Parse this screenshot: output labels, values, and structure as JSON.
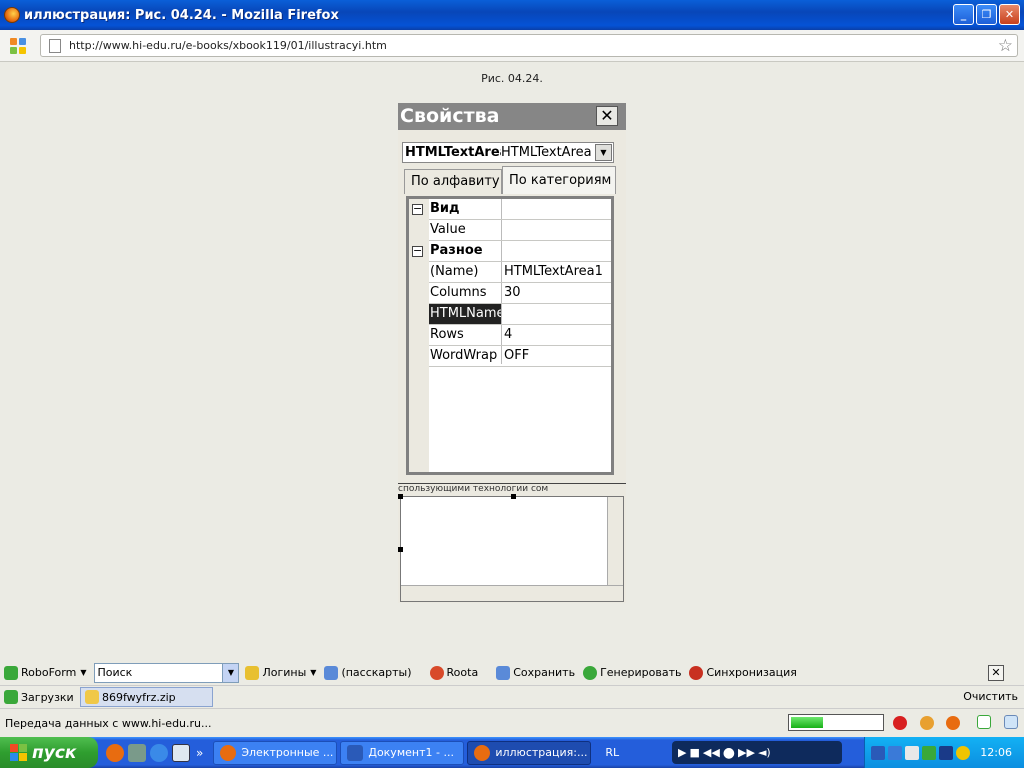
{
  "window": {
    "title": "иллюстрация: Рис. 04.24. - Mozilla Firefox",
    "minimize": "_",
    "restore": "❐",
    "close": "✕"
  },
  "address": {
    "url": "http://www.hi-edu.ru/e-books/xbook119/01/illustracyi.htm",
    "star": "☆"
  },
  "page": {
    "caption": "Рис. 04.24."
  },
  "properties_panel": {
    "title": "Свойства",
    "close": "✕",
    "object_name": "HTMLTextArea",
    "object_type": "HTMLTextArea",
    "dropdown_arrow": "▼",
    "tabs": [
      "По алфавиту",
      "По категориям"
    ],
    "rows": [
      {
        "key": "Вид",
        "value": "",
        "category": true
      },
      {
        "key": "Value",
        "value": ""
      },
      {
        "key": "Разное",
        "value": "",
        "category": true
      },
      {
        "key": "(Name)",
        "value": "HTMLTextArea1"
      },
      {
        "key": "Columns",
        "value": "30"
      },
      {
        "key": "HTMLName",
        "value": "",
        "selected": true
      },
      {
        "key": "Rows",
        "value": "4"
      },
      {
        "key": "WordWrap",
        "value": "OFF"
      }
    ],
    "expand_glyph": "⊟",
    "background_text": "спользующими технологии сом"
  },
  "robo_toolbar": {
    "roboform": "RoboForm",
    "search_placeholder": "Поиск",
    "logins": "Логины",
    "passcards": "(пасскарты)",
    "roota": "Roota",
    "save": "Сохранить",
    "generate": "Генерировать",
    "sync": "Синхронизация",
    "close": "✕"
  },
  "downloads": {
    "label": "Загрузки",
    "file": "869fwyfrz.zip",
    "clear": "Очистить"
  },
  "status": {
    "text": "Передача данных с www.hi-edu.ru...",
    "progress": 0.35
  },
  "taskbar": {
    "start": "пуск",
    "chevron": "»",
    "tasks": [
      {
        "label": "Электронные ...",
        "active": false
      },
      {
        "label": "Документ1 - ...",
        "active": false
      },
      {
        "label": "иллюстрация:...",
        "active": true
      }
    ],
    "lang": "RL",
    "clock": "12:06"
  },
  "colors": {
    "title_bar": "#0846b8",
    "taskbar": "#245edb",
    "start": "#2f9e2f",
    "tray": "#0c8ee0"
  }
}
